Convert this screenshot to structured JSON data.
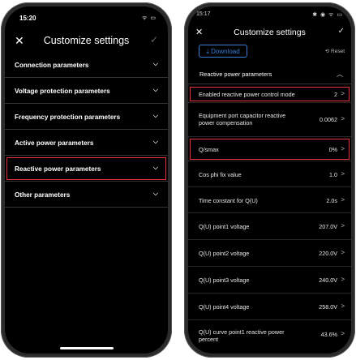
{
  "left_phone": {
    "time": "15:20",
    "status_icons": "ᯤ ▭",
    "close_symbol": "✕",
    "title": "Customize settings",
    "check_symbol": "✓",
    "items": [
      {
        "label": "Connection parameters",
        "chevron": "⌵"
      },
      {
        "label": "Voltage protection parameters",
        "chevron": "⌵"
      },
      {
        "label": "Frequency protection parameters",
        "chevron": "⌵"
      },
      {
        "label": "Active power parameters",
        "chevron": "⌵"
      },
      {
        "label": "Reactive power parameters",
        "chevron": "⌵"
      },
      {
        "label": "Other parameters",
        "chevron": "⌵"
      }
    ]
  },
  "right_phone": {
    "time": "15:17",
    "status_icons": "✱ ◉ ᯤ ▭",
    "close_symbol": "✕",
    "title": "Customize settings",
    "check_symbol": "✓",
    "download_label": "⤓ Download",
    "reset_label": "⟲ Reset",
    "section_label": "Reactive power parameters",
    "section_chevron": "︿",
    "items": [
      {
        "label": "Enabled reactive power control mode",
        "value": "2",
        "arrow": ">"
      },
      {
        "label": "Equipment port capacitor reactive power compensation",
        "value": "0.0062",
        "arrow": ">"
      },
      {
        "label": "Q/smax",
        "value": "0%",
        "arrow": ">"
      },
      {
        "label": "Cos phi fix value",
        "value": "1.0",
        "arrow": ">"
      },
      {
        "label": "Time constant for Q(U)",
        "value": "2.0s",
        "arrow": ">"
      },
      {
        "label": "Q(U) point1 voltage",
        "value": "207.0V",
        "arrow": ">"
      },
      {
        "label": "Q(U) point2 voltage",
        "value": "220.0V",
        "arrow": ">"
      },
      {
        "label": "Q(U) point3 voltage",
        "value": "240.0V",
        "arrow": ">"
      },
      {
        "label": "Q(U) point4 voltage",
        "value": "258.0V",
        "arrow": ">"
      },
      {
        "label": "Q(U) curve point1 reactive power percent",
        "value": "43.6%",
        "arrow": ">"
      }
    ]
  },
  "colors": {
    "highlight": "#e8333b",
    "accent": "#3a7bd5",
    "background": "#000000"
  }
}
